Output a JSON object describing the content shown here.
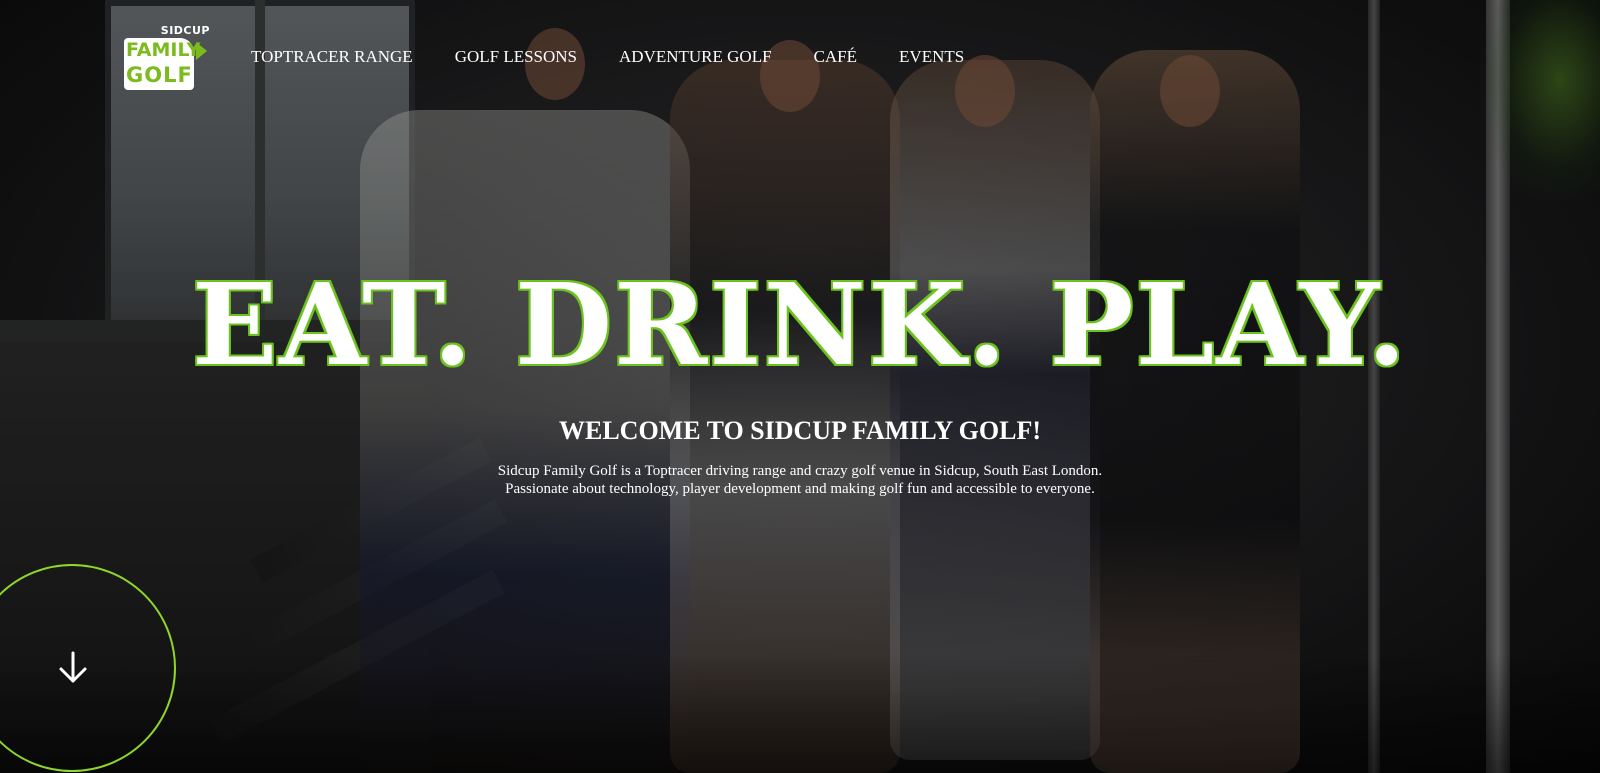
{
  "logo": {
    "top_text": "SIDCUP",
    "line1": "FAMILY",
    "line2": "GOLF"
  },
  "nav": {
    "items": [
      {
        "label": "TOPTRACER RANGE"
      },
      {
        "label": "GOLF LESSONS"
      },
      {
        "label": "ADVENTURE GOLF"
      },
      {
        "label": "CAFÉ"
      },
      {
        "label": "EVENTS"
      }
    ]
  },
  "hero": {
    "title": "EAT. DRINK. PLAY.",
    "subtitle": "WELCOME TO SIDCUP FAMILY GOLF!",
    "description_line1": "Sidcup Family Golf is a Toptracer driving range and crazy golf venue in Sidcup, South East London.",
    "description_line2": "Passionate about technology, player development and making golf fun and accessible to everyone."
  },
  "scroll_button": {
    "icon": "arrow-down-icon"
  },
  "colors": {
    "accent": "#7cbb1e",
    "title_outline": "#6cc31f",
    "text": "#ffffff"
  }
}
